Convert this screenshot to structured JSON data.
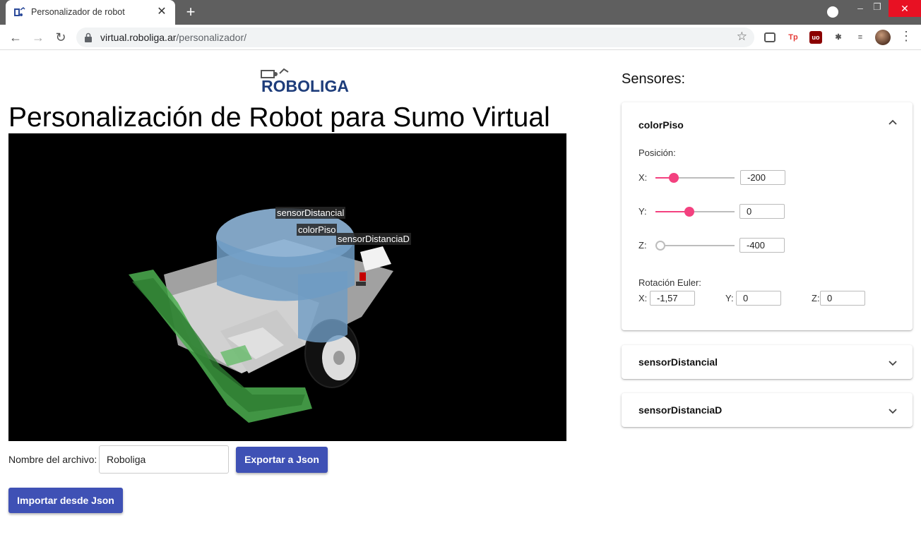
{
  "browser": {
    "tab_title": "Personalizador de robot",
    "url_host": "virtual.roboliga.ar",
    "url_path": "/personalizador/",
    "close_glyph": "✕",
    "newtab_glyph": "+",
    "back_glyph": "←",
    "forward_glyph": "→",
    "reload_glyph": "↻",
    "star_glyph": "☆",
    "menu_glyph": "⋮",
    "min_glyph": "–",
    "max_glyph": "❐",
    "winclose_glyph": "✕"
  },
  "extensions": [
    {
      "name": "screenshot-extension-icon",
      "glyph": "",
      "color": "#555555"
    },
    {
      "name": "tp-extension-icon",
      "glyph": "Tp",
      "color": "#e53935"
    },
    {
      "name": "ublock-icon",
      "glyph": "uo",
      "color": "#b71c1c"
    },
    {
      "name": "puzzle-extensions-icon",
      "glyph": "✱",
      "color": "#555555"
    },
    {
      "name": "media-queue-icon",
      "glyph": "≡",
      "color": "#555555"
    }
  ],
  "page": {
    "logo_text": "ROBOLIGA",
    "title": "Personalización de Robot para Sumo Virtual",
    "viewport_labels": [
      {
        "name": "label-sensor-distancial",
        "text": "sensorDistancial"
      },
      {
        "name": "label-color-piso",
        "text": "colorPiso"
      },
      {
        "name": "label-sensor-distancia-d",
        "text": "sensorDistanciaD"
      }
    ],
    "file_label": "Nombre del archivo:",
    "file_value": "Roboliga",
    "export_button": "Exportar a Json",
    "import_button": "Importar desde Json"
  },
  "sensors": {
    "title": "Sensores:",
    "panels": [
      {
        "name": "colorPiso",
        "expanded": true,
        "position_label": "Posición:",
        "axes": [
          {
            "label": "X:",
            "value": "-200",
            "slider_level": 0.23
          },
          {
            "label": "Y:",
            "value": "0",
            "slider_level": 0.43
          },
          {
            "label": "Z:",
            "value": "-400",
            "slider_level": 0.0
          }
        ],
        "rotation_label": "Rotación Euler:",
        "rotation": [
          {
            "label": "X:",
            "value": "-1,57"
          },
          {
            "label": "Y:",
            "value": "0"
          },
          {
            "label": "Z:",
            "value": "0"
          }
        ]
      },
      {
        "name": "sensorDistancial",
        "expanded": false
      },
      {
        "name": "sensorDistanciaD",
        "expanded": false
      }
    ]
  },
  "colors": {
    "accent": "#3f51b5",
    "slider": "#f3417f",
    "bumper": "#4caf50",
    "sensor_blue": "#7fa7c9"
  }
}
